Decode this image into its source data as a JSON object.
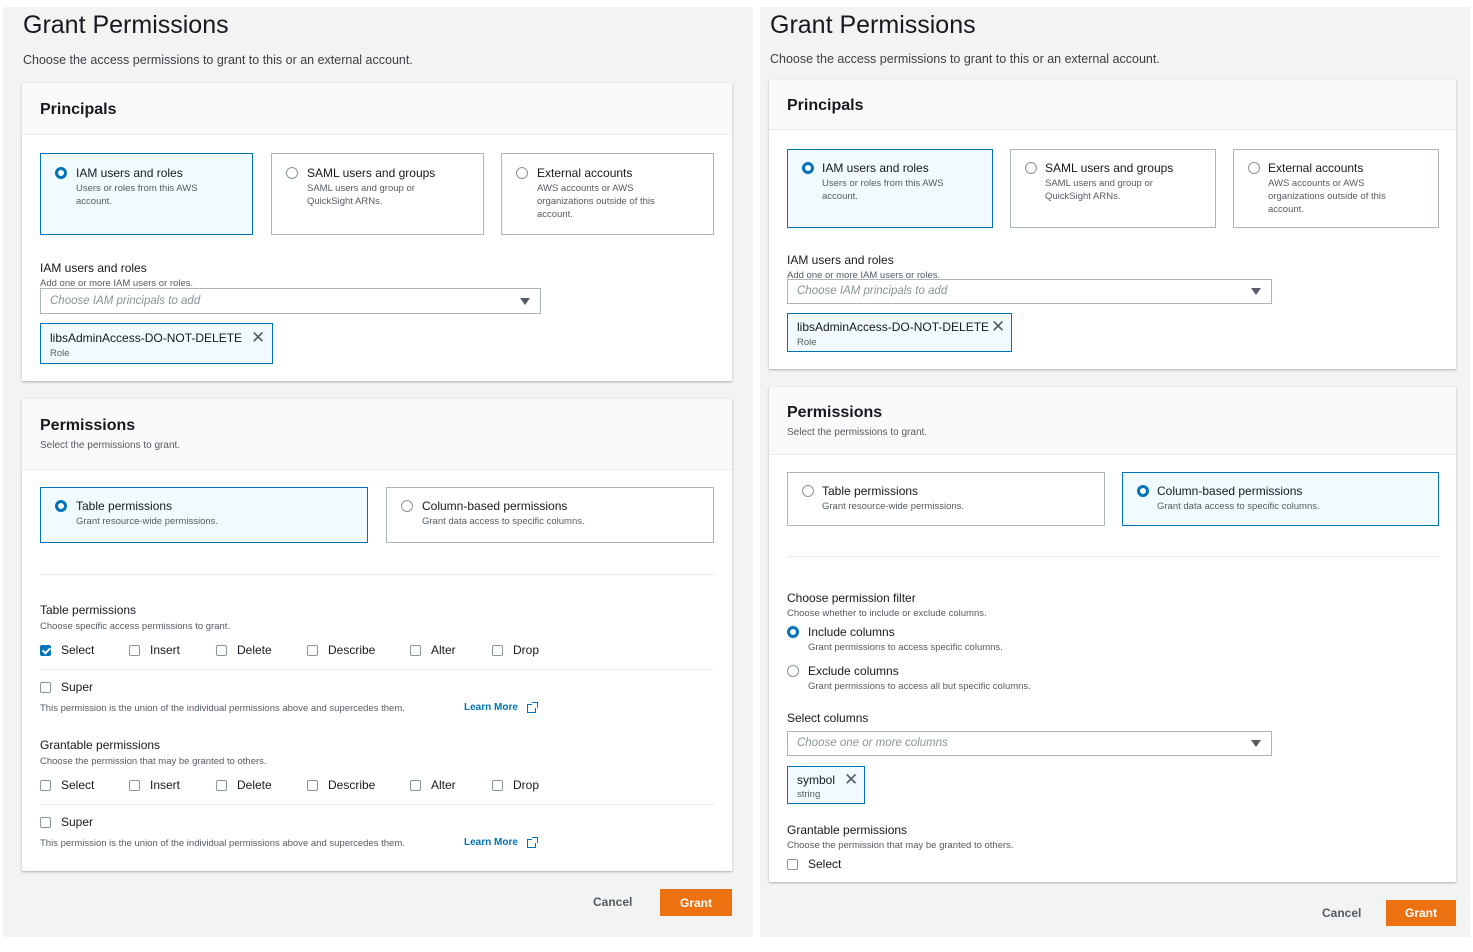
{
  "left": {
    "title": "Grant Permissions",
    "subtitle": "Choose the access permissions to grant to this or an external account.",
    "principals": {
      "heading": "Principals",
      "tiles": [
        {
          "label": "IAM users and roles",
          "desc": "Users or roles from this AWS account.",
          "selected": true
        },
        {
          "label": "SAML users and groups",
          "desc": "SAML users and group or QuickSight ARNs.",
          "selected": false
        },
        {
          "label": "External accounts",
          "desc": "AWS accounts or AWS organizations outside of this account.",
          "selected": false
        }
      ],
      "field_label": "IAM users and roles",
      "field_desc": "Add one or more IAM users or roles.",
      "placeholder": "Choose IAM principals to add",
      "token_name": "libsAdminAccess-DO-NOT-DELETE",
      "token_type": "Role"
    },
    "permissions": {
      "heading": "Permissions",
      "desc": "Select the permissions to grant.",
      "tiles": [
        {
          "label": "Table permissions",
          "desc": "Grant resource-wide permissions.",
          "selected": true
        },
        {
          "label": "Column-based permissions",
          "desc": "Grant data access to specific columns.",
          "selected": false
        }
      ],
      "table_label": "Table permissions",
      "table_desc": "Choose specific access permissions to grant.",
      "table_checks": [
        {
          "label": "Select",
          "checked": true
        },
        {
          "label": "Insert",
          "checked": false
        },
        {
          "label": "Delete",
          "checked": false
        },
        {
          "label": "Describe",
          "checked": false
        },
        {
          "label": "Alter",
          "checked": false
        },
        {
          "label": "Drop",
          "checked": false
        }
      ],
      "super_label": "Super",
      "super_note": "This permission is the union of the individual permissions above and supercedes them.",
      "learn_more": "Learn More",
      "grantable_label": "Grantable permissions",
      "grantable_desc": "Choose the permission that may be granted to others.",
      "grantable_checks": [
        {
          "label": "Select",
          "checked": false
        },
        {
          "label": "Insert",
          "checked": false
        },
        {
          "label": "Delete",
          "checked": false
        },
        {
          "label": "Describe",
          "checked": false
        },
        {
          "label": "Alter",
          "checked": false
        },
        {
          "label": "Drop",
          "checked": false
        }
      ],
      "super2_label": "Super",
      "super2_note": "This permission is the union of the individual permissions above and supercedes them.",
      "learn_more2": "Learn More"
    },
    "cancel": "Cancel",
    "grant": "Grant"
  },
  "right": {
    "title": "Grant Permissions",
    "subtitle": "Choose the access permissions to grant to this or an external account.",
    "principals": {
      "heading": "Principals",
      "tiles": [
        {
          "label": "IAM users and roles",
          "desc": "Users or roles from this AWS account.",
          "selected": true
        },
        {
          "label": "SAML users and groups",
          "desc": "SAML users and group or QuickSight ARNs.",
          "selected": false
        },
        {
          "label": "External accounts",
          "desc": "AWS accounts or AWS organizations outside of this account.",
          "selected": false
        }
      ],
      "field_label": "IAM users and roles",
      "field_desc": "Add one or more IAM users or roles.",
      "placeholder": "Choose IAM principals to add",
      "token_name": "libsAdminAccess-DO-NOT-DELETE",
      "token_type": "Role"
    },
    "permissions": {
      "heading": "Permissions",
      "desc": "Select the permissions to grant.",
      "tiles": [
        {
          "label": "Table permissions",
          "desc": "Grant resource-wide permissions.",
          "selected": false
        },
        {
          "label": "Column-based permissions",
          "desc": "Grant data access to specific columns.",
          "selected": true
        }
      ],
      "filter_label": "Choose permission filter",
      "filter_desc": "Choose whether to include or exclude columns.",
      "filter_options": [
        {
          "label": "Include columns",
          "desc": "Grant permissions to access specific columns.",
          "selected": true
        },
        {
          "label": "Exclude columns",
          "desc": "Grant permissions to access all but specific columns.",
          "selected": false
        }
      ],
      "columns_label": "Select columns",
      "columns_placeholder": "Choose one or more columns",
      "column_token_name": "symbol",
      "column_token_type": "string",
      "grantable_label": "Grantable permissions",
      "grantable_desc": "Choose the permission that may be granted to others.",
      "grantable_checks": [
        {
          "label": "Select",
          "checked": false
        }
      ]
    },
    "cancel": "Cancel",
    "grant": "Grant"
  }
}
